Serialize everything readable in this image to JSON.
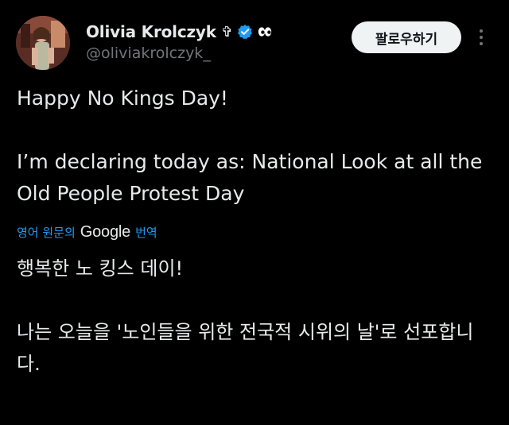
{
  "post": {
    "author": {
      "display_name": "Olivia Krolczyk",
      "name_emoji_1": "✞",
      "name_emoji_2": "eyes-icon",
      "handle": "@oliviakrolczyk_",
      "verified": true
    },
    "follow_label": "팔로우하기",
    "more_icon": "more-vertical-icon",
    "text": "Happy No Kings Day!\n\nI’m declaring today as: National Look at all the Old People Protest Day",
    "translation": {
      "source_label": "영어 원문의",
      "provider": "Google",
      "action_label": "번역",
      "text": "행복한 노 킹스 데이!\n\n나는 오늘을 '노인들을 위한 전국적 시위의 날'로 선포합니다."
    }
  },
  "colors": {
    "background": "#000000",
    "text_primary": "#e7e9ea",
    "text_secondary": "#71767b",
    "accent": "#1d9bf0",
    "button_bg": "#eff3f4"
  }
}
